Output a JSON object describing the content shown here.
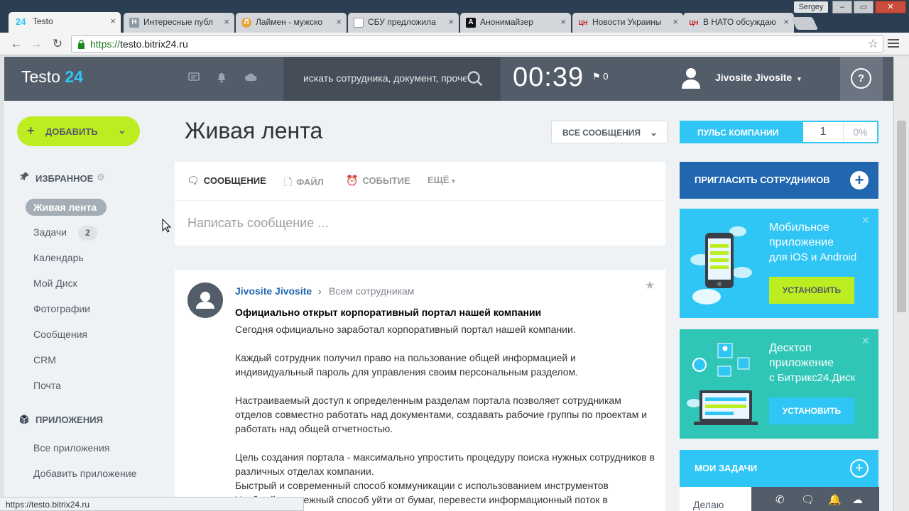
{
  "browser": {
    "tabs": [
      {
        "title": "Testo",
        "favicon": "24"
      },
      {
        "title": "Интересные публ",
        "favicon": "H"
      },
      {
        "title": "Лаймен - мужско",
        "favicon": "Л"
      },
      {
        "title": "СБУ предложила",
        "favicon": "doc"
      },
      {
        "title": "Анонимайзер",
        "favicon": "A"
      },
      {
        "title": "Новости Украины",
        "favicon": "ЦН"
      },
      {
        "title": "В НАТО обсуждаю",
        "favicon": "ЦН"
      }
    ],
    "user": "Sergey",
    "url_scheme": "https://",
    "url_host": "testo.bitrix24.ru",
    "status_url": "https://testo.bitrix24.ru"
  },
  "header": {
    "logo_name": "Testo",
    "logo_num": "24",
    "search_placeholder": "искать сотрудника, документ, прочее...",
    "timer": "00:39",
    "flag_count": "0",
    "user_name": "Jivosite Jivosite",
    "help": "?"
  },
  "sidebar": {
    "add_label": "ДОБАВИТЬ",
    "favorites_title": "ИЗБРАННОЕ",
    "items": [
      {
        "label": "Живая лента",
        "active": true
      },
      {
        "label": "Задачи",
        "counter": "2"
      },
      {
        "label": "Календарь"
      },
      {
        "label": "Мой Диск"
      },
      {
        "label": "Фотографии"
      },
      {
        "label": "Сообщения"
      },
      {
        "label": "CRM"
      },
      {
        "label": "Почта"
      }
    ],
    "apps_title": "ПРИЛОЖЕНИЯ",
    "apps": [
      {
        "label": "Все приложения"
      },
      {
        "label": "Добавить приложение"
      }
    ]
  },
  "main": {
    "title": "Живая лента",
    "filter_label": "ВСЕ СООБЩЕНИЯ",
    "composer_tabs": [
      "СООБЩЕНИЕ",
      "ФАЙЛ",
      "СОБЫТИЕ",
      "ЕЩЁ"
    ],
    "composer_placeholder": "Написать сообщение ...",
    "post": {
      "author": "Jivosite Jivosite",
      "destination": "Всем сотрудникам",
      "title": "Официально открыт корпоративный портал нашей компании",
      "paragraphs": [
        "Сегодня официально заработал корпоративный портал нашей компании.",
        "Каждый сотрудник получил право на пользование общей информацией и индивидуальный пароль для управления своим персональным разделом.",
        "Настраиваемый доступ к определенным разделам портала позволяет сотрудникам отделов совместно работать над документами, создавать рабочие группы по проектам и работать над общей отчетностью.",
        "Цель создания портала - максимально упростить процедуру поиска нужных сотрудников в различных отделах компании.",
        "Быстрый и современный способ коммуникации с использованием инструментов",
        "Удобный и надежный способ уйти от бумаг, перевести информационный поток в"
      ]
    }
  },
  "right": {
    "pulse_label": "ПУЛЬС КОМПАНИИ",
    "pulse_value": "1",
    "pulse_percent": "0%",
    "invite_label": "ПРИГЛАСИТЬ СОТРУДНИКОВ",
    "mobile_title": "Мобильное приложение",
    "mobile_sub": "для iOS и Android",
    "install": "УСТАНОВИТЬ",
    "desktop_title": "Десктоп приложение",
    "desktop_sub": "с Битрикс24.Диск",
    "tasks_label": "МОИ ЗАДАЧИ",
    "tasks_row": "Делаю"
  },
  "colors": {
    "accent_green": "#bbed21",
    "accent_blue": "#2fc6f6",
    "dark_blue": "#2067b0",
    "header_bg": "#535c69",
    "promo_mobile": "#2fc6f6",
    "promo_desktop": "#2fc6b8"
  }
}
